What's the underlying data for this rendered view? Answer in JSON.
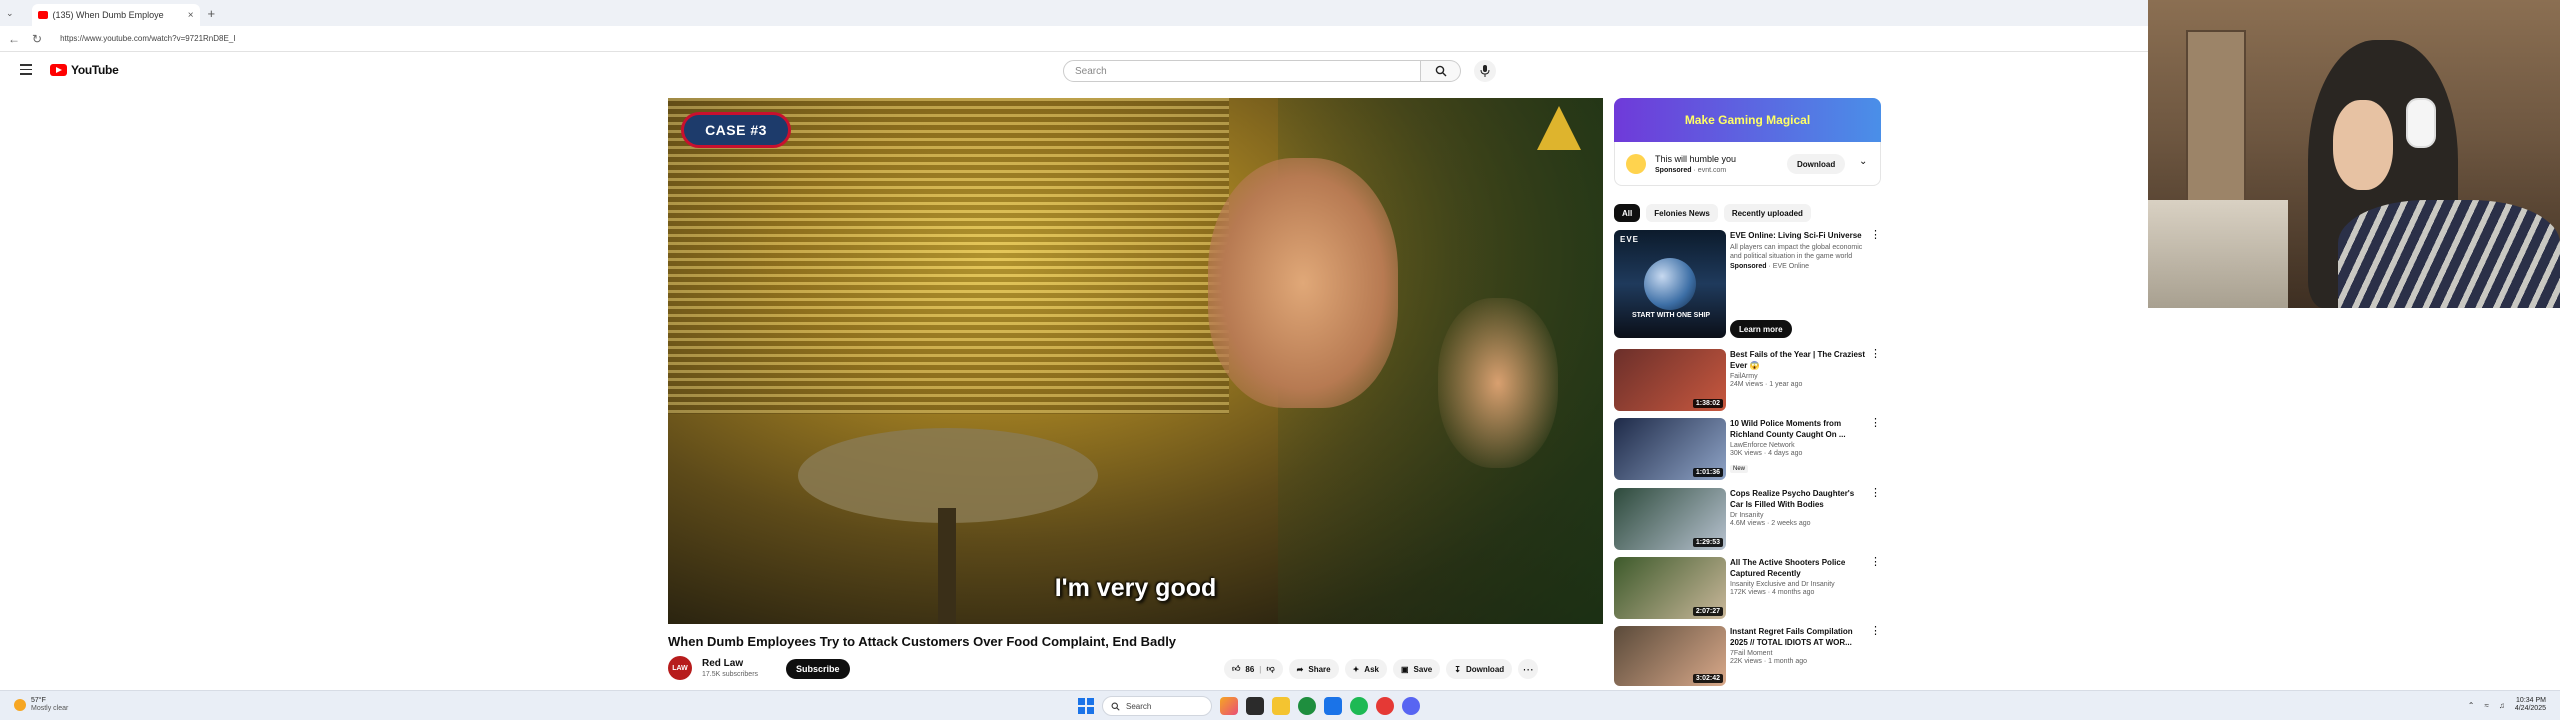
{
  "browser": {
    "tab_title": "(135) When Dumb Employe",
    "tab_close": "×",
    "new_tab": "+",
    "tab_dropdown": "⌄",
    "url": "https://www.youtube.com/watch?v=9721RnD8E_I"
  },
  "masthead": {
    "logo_text": "YouTube",
    "search_placeholder": "Search"
  },
  "player": {
    "badge": "CASE #3",
    "caption": "I'm very good"
  },
  "video": {
    "title": "When Dumb Employees Try to Attack Customers Over Food Complaint, End Badly",
    "channel": "Red Law",
    "channel_avatar_text": "LAW",
    "subscribers": "17.5K subscribers",
    "subscribe_label": "Subscribe",
    "likes": "86",
    "share_label": "Share",
    "ask_label": "Ask",
    "save_label": "Save",
    "download_label": "Download",
    "more_label": "⋯"
  },
  "ad": {
    "banner": "Make Gaming Magical",
    "title": "This will humble you",
    "sponsored": "Sponsored",
    "domain": "evnt.com",
    "download_label": "Download"
  },
  "chips": [
    "All",
    "Felonies News",
    "Recently uploaded"
  ],
  "promo": {
    "title": "EVE Online: Living Sci-Fi Universe",
    "description": "All players can impact the global economic and political situation in the game world",
    "sponsored": "Sponsored",
    "advertiser": "EVE Online",
    "cta": "Learn more",
    "thumb_logo": "EVE",
    "thumb_text": "START WITH ONE SHIP"
  },
  "recommendations": [
    {
      "title": "Best Fails of the Year | The Craziest Ever 😱",
      "channel": "FailArmy",
      "meta": "24M views · 1 year ago",
      "duration": "1:38:02",
      "badge": "",
      "color1": "#6b2f2a",
      "color2": "#c8583f"
    },
    {
      "title": "10 Wild Police Moments from Richland County Caught On ...",
      "channel": "LawEnforce Network",
      "meta": "30K views · 4 days ago",
      "duration": "1:01:36",
      "badge": "New",
      "color1": "#1e2a48",
      "color2": "#8fa4c7"
    },
    {
      "title": "Cops Realize Psycho Daughter's Car Is Filled With Bodies",
      "channel": "Dr Insanity",
      "meta": "4.6M views · 2 weeks ago",
      "duration": "1:29:53",
      "badge": "",
      "color1": "#2d4a3b",
      "color2": "#b7c2d0"
    },
    {
      "title": "All The Active Shooters Police Captured Recently",
      "channel": "Insanity Exclusive and Dr Insanity",
      "meta": "172K views · 4 months ago",
      "duration": "2:07:27",
      "badge": "",
      "color1": "#3d5a2b",
      "color2": "#c9b79a"
    },
    {
      "title": "Instant Regret Fails Compilation 2025 // TOTAL IDIOTS AT WOR...",
      "channel": "7Fail Moment",
      "meta": "22K views · 1 month ago",
      "duration": "3:02:42",
      "badge": "",
      "color1": "#5a4a3a",
      "color2": "#d9a98a"
    }
  ],
  "taskbar": {
    "weather_temp": "57°F",
    "weather_desc": "Mostly clear",
    "search": "Search",
    "time": "10:34 PM",
    "date": "4/24/2025"
  },
  "colors": {
    "youtube_red": "#ff0000",
    "accent_dark": "#0f0f0f",
    "ad_gradient_start": "#6f3ad9",
    "ad_gradient_end": "#4a8fe8",
    "ad_text": "#ffff66"
  }
}
